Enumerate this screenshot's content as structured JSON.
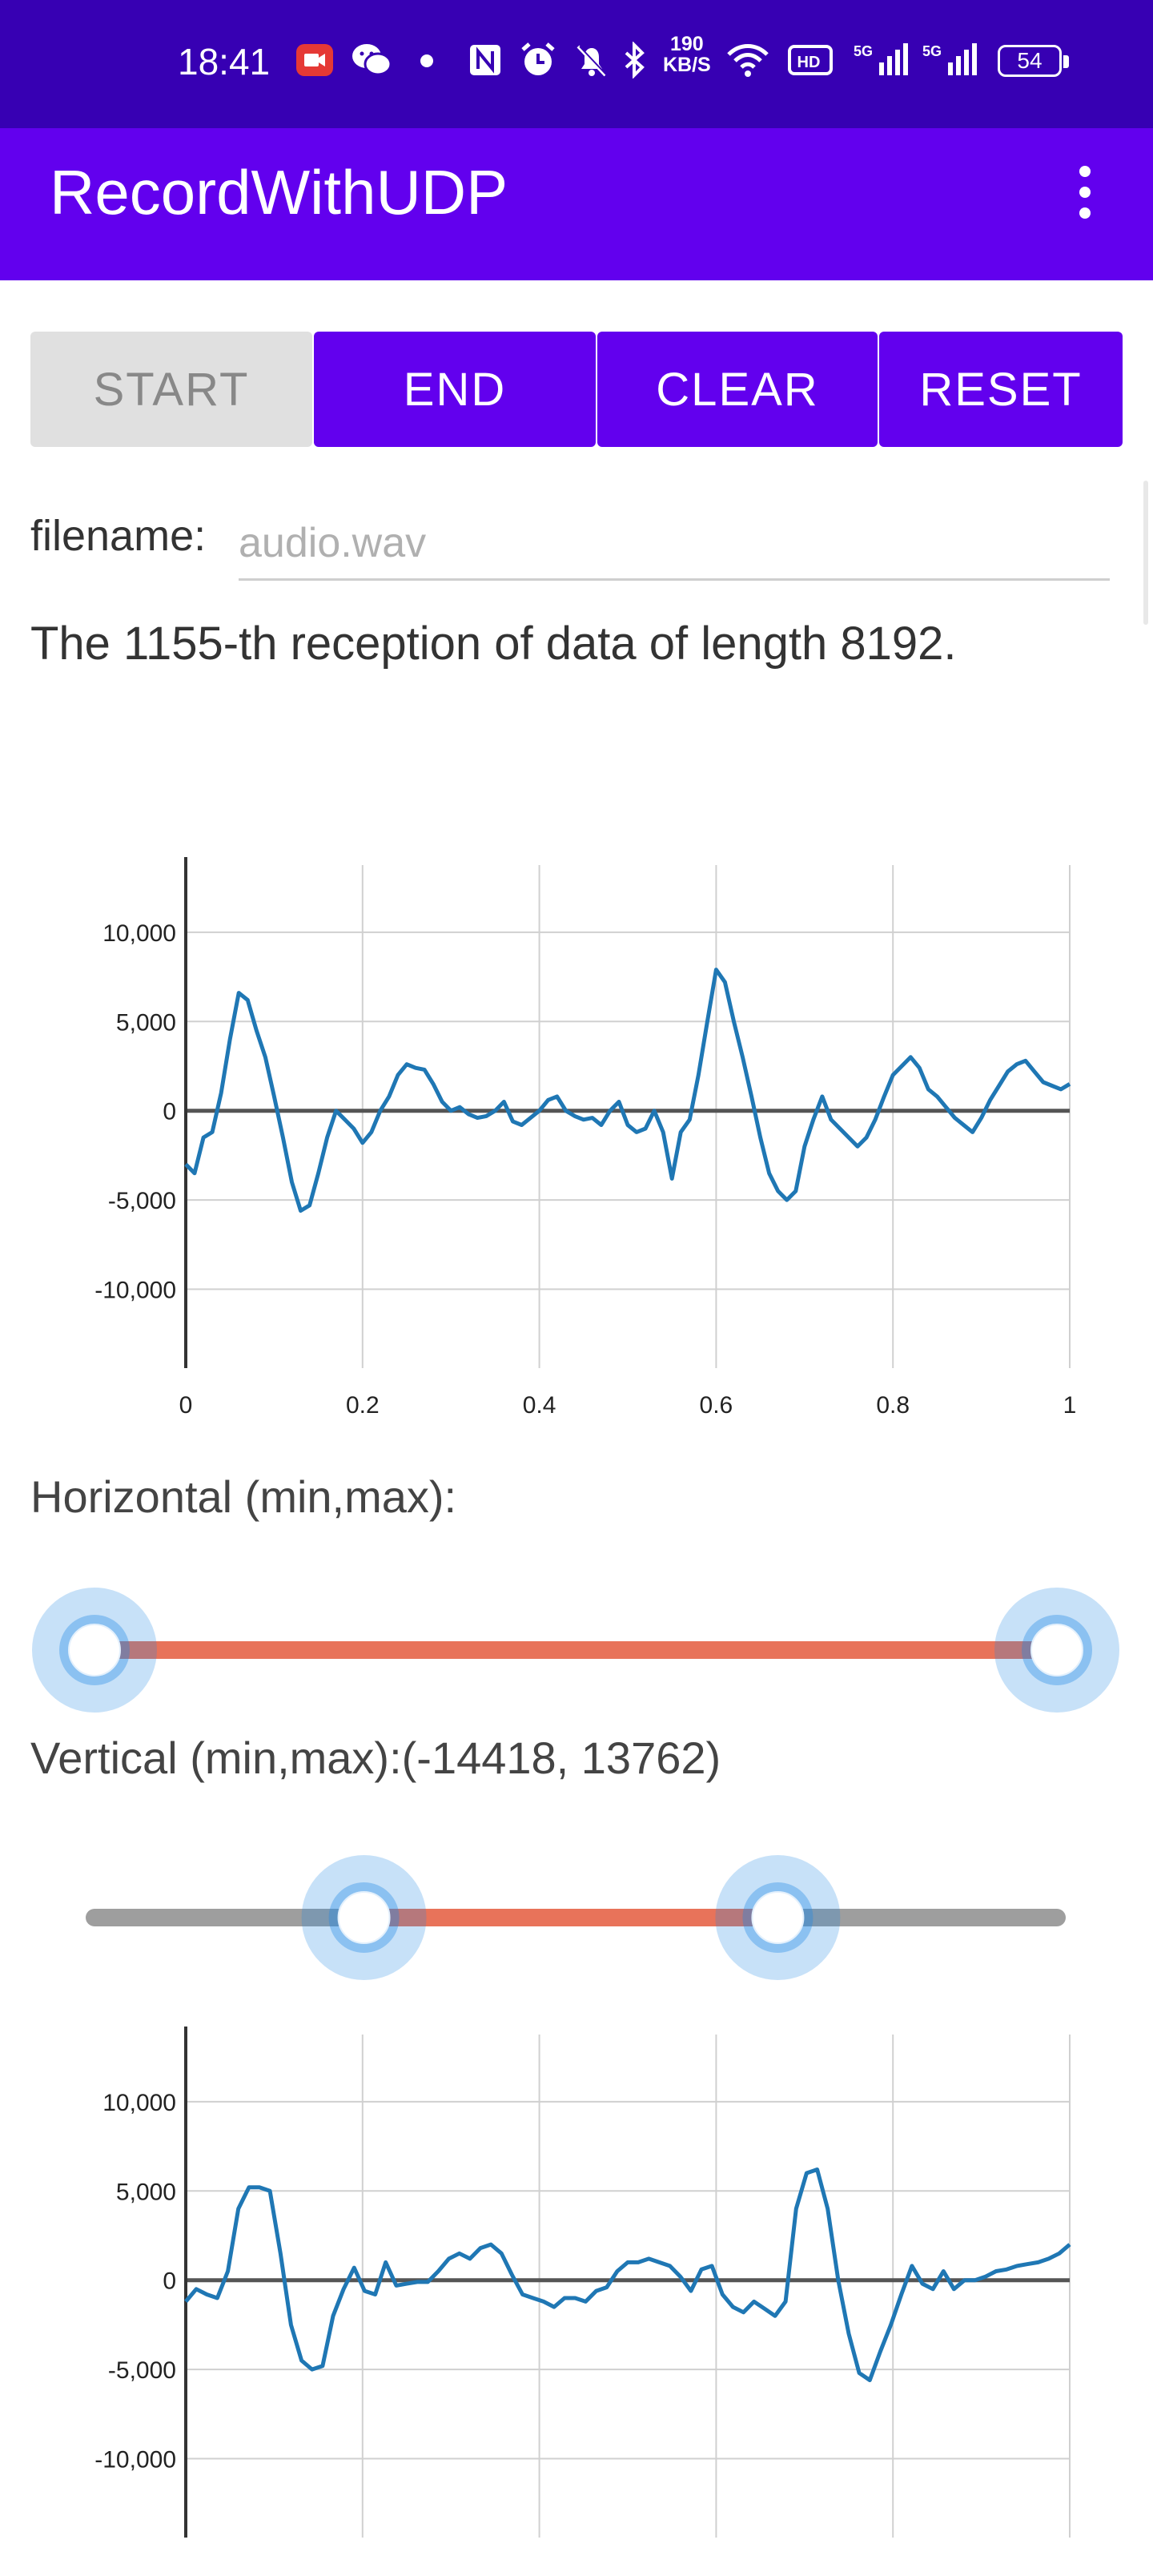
{
  "status_bar": {
    "time": "18:41",
    "speed_value": "190",
    "speed_unit": "KB/S",
    "battery": "54",
    "icons": [
      "screen-record-icon",
      "wechat-icon",
      "dot-icon",
      "nfc-icon",
      "alarm-icon",
      "mute-icon",
      "bluetooth-icon",
      "wifi-icon",
      "hd-icon",
      "signal-5g-icon",
      "signal-5g-icon"
    ]
  },
  "app_bar": {
    "title": "RecordWithUDP",
    "menu_icon": "more-vert-icon"
  },
  "buttons": {
    "start": "START",
    "end": "END",
    "clear": "CLEAR",
    "reset": "RESET"
  },
  "filename": {
    "label": "filename:",
    "placeholder": "audio.wav",
    "value": ""
  },
  "status_text": "The 1155-th reception of data of length 8192.",
  "horizontal_slider": {
    "label": "Horizontal (min,max):",
    "min": 0,
    "max": 1,
    "low": 0,
    "high": 1
  },
  "vertical_slider": {
    "label": "Vertical (min,max):(-14418, 13762)",
    "min": -32768,
    "max": 32767,
    "low": -14418,
    "high": 13762
  },
  "colors": {
    "primary": "#6200ee",
    "status_bar": "#3700b3",
    "series": "#1f77b4",
    "slider_active": "#e8735a"
  },
  "chart_data": [
    {
      "type": "line",
      "xlim": [
        0,
        1
      ],
      "ylim": [
        -14418,
        13762
      ],
      "x_ticks": [
        0,
        0.2,
        0.4,
        0.6,
        0.8,
        1
      ],
      "x_tick_labels": [
        "0",
        "0.2",
        "0.4",
        "0.6",
        "0.8",
        "1"
      ],
      "y_ticks": [
        10000,
        5000,
        0,
        -5000,
        -10000
      ],
      "y_tick_labels": [
        "10,000",
        "5,000",
        "0",
        "-5,000",
        "-10,000"
      ],
      "grid": true,
      "x": [
        0,
        0.01,
        0.02,
        0.03,
        0.04,
        0.05,
        0.06,
        0.07,
        0.08,
        0.09,
        0.1,
        0.11,
        0.12,
        0.13,
        0.14,
        0.15,
        0.16,
        0.17,
        0.18,
        0.19,
        0.2,
        0.21,
        0.22,
        0.23,
        0.24,
        0.25,
        0.26,
        0.27,
        0.28,
        0.29,
        0.3,
        0.31,
        0.32,
        0.33,
        0.34,
        0.35,
        0.36,
        0.37,
        0.38,
        0.39,
        0.4,
        0.41,
        0.42,
        0.43,
        0.44,
        0.45,
        0.46,
        0.47,
        0.48,
        0.49,
        0.5,
        0.51,
        0.52,
        0.53,
        0.54,
        0.55,
        0.56,
        0.57,
        0.58,
        0.59,
        0.6,
        0.61,
        0.62,
        0.63,
        0.64,
        0.65,
        0.66,
        0.67,
        0.68,
        0.69,
        0.7,
        0.71,
        0.72,
        0.73,
        0.74,
        0.75,
        0.76,
        0.77,
        0.78,
        0.79,
        0.8,
        0.81,
        0.82,
        0.83,
        0.84,
        0.85,
        0.86,
        0.87,
        0.88,
        0.89,
        0.9,
        0.91,
        0.92,
        0.93,
        0.94,
        0.95,
        0.96,
        0.97,
        0.98,
        0.99,
        1.0
      ],
      "y": [
        -3000,
        -3500,
        -1500,
        -1200,
        1000,
        4000,
        6600,
        6200,
        4500,
        3000,
        800,
        -1500,
        -4000,
        -5600,
        -5300,
        -3500,
        -1500,
        0,
        -500,
        -1000,
        -1800,
        -1200,
        0,
        800,
        2000,
        2600,
        2400,
        2300,
        1500,
        500,
        0,
        200,
        -200,
        -400,
        -300,
        0,
        500,
        -600,
        -800,
        -400,
        0,
        600,
        800,
        0,
        -300,
        -500,
        -400,
        -800,
        0,
        500,
        -800,
        -1200,
        -1000,
        0,
        -1200,
        -3800,
        -1200,
        -500,
        2000,
        5000,
        7900,
        7200,
        5000,
        3000,
        800,
        -1500,
        -3500,
        -4500,
        -5000,
        -4500,
        -2000,
        -500,
        800,
        -500,
        -1000,
        -1500,
        -2000,
        -1500,
        -500,
        800,
        2000,
        2500,
        3000,
        2400,
        1200,
        800,
        200,
        -400,
        -800,
        -1200,
        -400,
        600,
        1400,
        2200,
        2600,
        2800,
        2200,
        1600,
        1400,
        1200,
        1500
      ]
    },
    {
      "type": "line",
      "xlim": [
        0,
        1
      ],
      "ylim": [
        -14418,
        13762
      ],
      "x_ticks": [
        0,
        0.2,
        0.4,
        0.6,
        0.8,
        1
      ],
      "x_tick_labels": [
        "0",
        "0.2",
        "0.4",
        "0.6",
        "0.8",
        "1"
      ],
      "y_ticks": [
        10000,
        5000,
        0,
        -5000,
        -10000
      ],
      "y_tick_labels": [
        "10,000",
        "5,000",
        "0",
        "-5,000",
        "-10,000"
      ],
      "grid": true,
      "x": [
        0,
        0.01,
        0.02,
        0.03,
        0.04,
        0.05,
        0.06,
        0.07,
        0.08,
        0.09,
        0.1,
        0.11,
        0.12,
        0.13,
        0.14,
        0.15,
        0.16,
        0.17,
        0.18,
        0.19,
        0.2,
        0.21,
        0.22,
        0.23,
        0.24,
        0.25,
        0.26,
        0.27,
        0.28,
        0.29,
        0.3,
        0.31,
        0.32,
        0.33,
        0.34,
        0.35,
        0.36,
        0.37,
        0.38,
        0.39,
        0.4,
        0.41,
        0.42,
        0.43,
        0.44,
        0.45,
        0.46,
        0.47,
        0.48,
        0.49,
        0.5,
        0.51,
        0.52,
        0.53,
        0.54,
        0.55,
        0.56,
        0.57,
        0.58,
        0.59,
        0.6,
        0.61,
        0.62,
        0.63,
        0.64,
        0.65,
        0.66,
        0.67,
        0.68,
        0.69,
        0.7,
        0.71,
        0.72,
        0.73,
        0.74,
        0.75,
        0.76,
        0.77,
        0.78,
        0.79,
        0.8,
        0.81,
        0.82,
        0.83,
        0.84,
        0.85,
        0.86,
        0.87,
        0.88,
        0.89,
        0.9,
        0.91,
        0.92,
        0.93,
        0.94,
        0.95,
        0.96,
        0.97,
        0.98,
        0.99,
        1.0
      ],
      "y": [
        -1200,
        -500,
        -800,
        -1000,
        500,
        4000,
        5200,
        5200,
        5000,
        1500,
        -2500,
        -4500,
        -5000,
        -4800,
        -2000,
        -500,
        700,
        -600,
        -800,
        1000,
        -300,
        -200,
        -100,
        -100,
        500,
        1200,
        1500,
        1200,
        1800,
        2000,
        1500,
        300,
        -800,
        -1000,
        -1200,
        -1500,
        -1000,
        -1000,
        -1200,
        -600,
        -400,
        500,
        1000,
        1000,
        1200,
        1000,
        800,
        200,
        -600,
        600,
        800,
        -800,
        -1500,
        -1800,
        -1200,
        -1600,
        -2000,
        -1200,
        4000,
        6000,
        6200,
        4000,
        0,
        -3000,
        -5200,
        -5600,
        -4000,
        -2500,
        -800,
        800,
        -200,
        -500,
        500,
        -500,
        0,
        0,
        200,
        500,
        600,
        800,
        900,
        1000,
        1200,
        1500,
        2000
      ]
    }
  ]
}
